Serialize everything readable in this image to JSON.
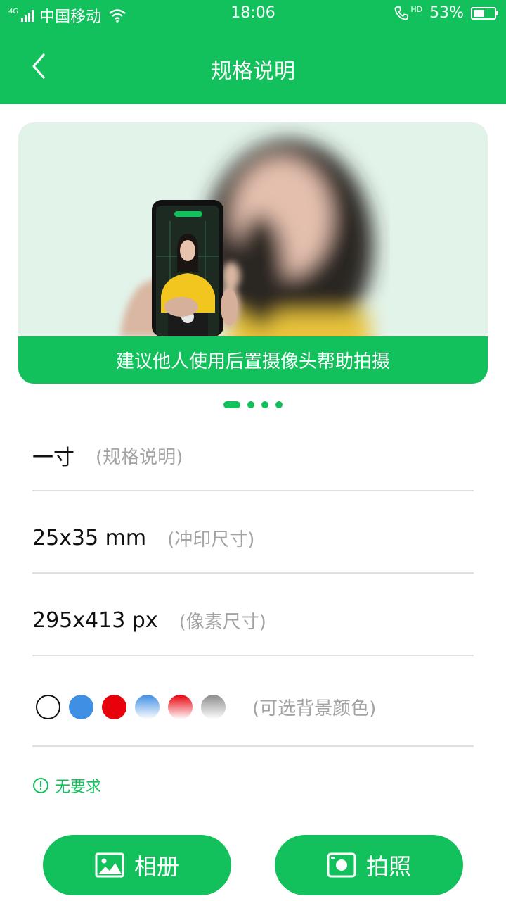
{
  "status_bar": {
    "network": "4G",
    "carrier": "中国移动",
    "time": "18:06",
    "hd": "HD",
    "battery_percent": "53%",
    "battery_level": 0.53
  },
  "header": {
    "title": "规格说明",
    "back_icon": "chevron-left-icon"
  },
  "banner": {
    "caption": "建议他人使用后置摄像头帮助拍摄",
    "dots": 4,
    "active_dot": 0
  },
  "spec": {
    "size_name": "一寸",
    "size_name_note": "(规格说明)",
    "print_size": "25x35 mm",
    "print_size_note": "(冲印尺寸)",
    "pixel_size": "295x413 px",
    "pixel_size_note": "(像素尺寸)",
    "bg_colors_note": "(可选背景颜色)",
    "bg_colors": [
      "white",
      "blue",
      "red",
      "blue-gradient",
      "red-gradient",
      "gray-gradient"
    ]
  },
  "note": {
    "icon": "info-icon",
    "text": "无要求"
  },
  "actions": {
    "album_label": "相册",
    "album_icon": "image-icon",
    "photo_label": "拍照",
    "photo_icon": "camera-icon"
  },
  "colors": {
    "accent": "#12c05c",
    "banner_bg": "#e2f3ea",
    "muted_text": "#a3a3a3",
    "divider": "#e0e0e0"
  }
}
